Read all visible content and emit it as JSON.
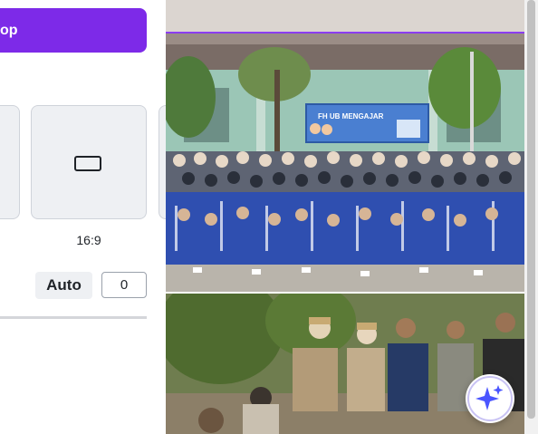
{
  "panel": {
    "crop_button_label": "op",
    "ratio_label": "16:9",
    "auto_label": "Auto",
    "number_value": "0"
  },
  "canvas": {
    "photo1_banner_text": "FH UB MENGAJAR"
  },
  "colors": {
    "accent": "#7d2ae8",
    "selection": "#8b3df0",
    "magic_star": "#4a55ff"
  },
  "icons": {
    "ratio_icon": "rectangle-16-9-icon",
    "magic_button_icon": "sparkle-icon"
  }
}
